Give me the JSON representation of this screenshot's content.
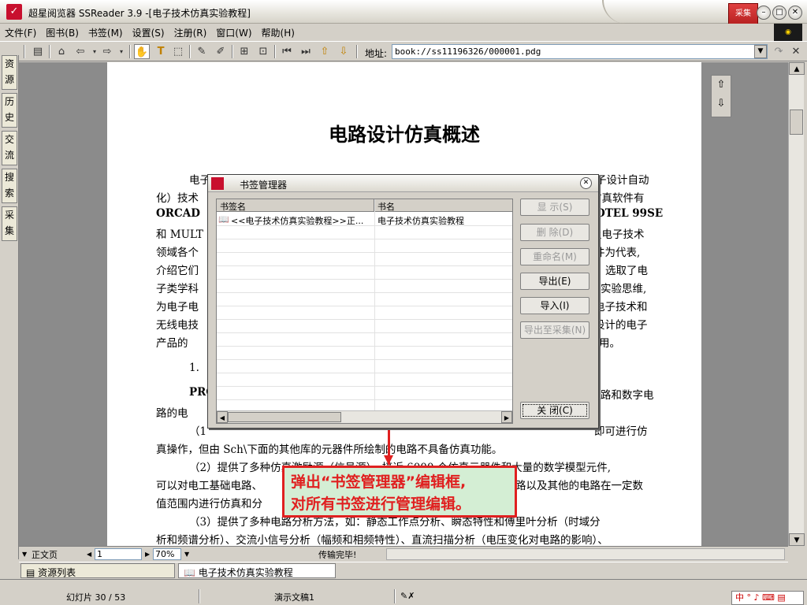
{
  "window": {
    "title": "超星阅览器 SSReader 3.9 -[电子技术仿真实验教程]",
    "badge_text": "采集"
  },
  "menu": [
    "文件(F)",
    "图书(B)",
    "书签(M)",
    "设置(S)",
    "注册(R)",
    "窗口(W)",
    "帮助(H)"
  ],
  "toolbar": {
    "address_label": "地址:",
    "address_value": "book://ss11196326/000001.pdg",
    "text_tool": "T"
  },
  "left_tabs": [
    "资源",
    "历史",
    "交流",
    "搜索",
    "采集"
  ],
  "document": {
    "title": "电路设计仿真概述",
    "lines": [
      "电子",
      "子设计自动",
      "化）技术",
      "仿真软件有",
      "ORCAD",
      "OTEL 99SE",
      "和 MULT",
      "及电子技术",
      "领域各个",
      "件为代表,",
      "介绍它们",
      "选取了电",
      "子类学科",
      "实验思维,",
      "为电子电",
      "电子技术和",
      "无线电技",
      "设计的电子",
      "产品的",
      "用。",
      "1.",
      "PRO",
      "路和数字电",
      "路的电",
      "（1",
      "即可进行仿",
      "真操作，但由 Sch\\下面的其他库的元器件所绘制的电路不具备仿真功能。",
      "（2）提供了多种仿真激励源（信号源），接近 6000 个仿真元器件和大量的数学模型元件,",
      "可以对电工基础电路、",
      "路以及其他的电路在一定数",
      "值范围内进行仿真和分",
      "（3）提供了多种电路分析方法，如：静态工作点分析、瞬态特性和傅里叶分析（时域分",
      "析和频谱分析）、交流小信号分析（幅频和相频特性）、直流扫描分析（电压变化对电路的影响）、"
    ]
  },
  "callout": {
    "line1": "弹出“书签管理器”编辑框,",
    "line2": "对所有书签进行管理编辑。"
  },
  "dialog": {
    "title": "书签管理器",
    "columns": [
      "书签名",
      "书名"
    ],
    "rows": [
      {
        "bookmark": "<<电子技术仿真实验教程>>正...",
        "book": "电子技术仿真实验教程"
      }
    ],
    "buttons": {
      "show": "显  示(S)",
      "delete": "删  除(D)",
      "rename": "重命名(M)",
      "export": "导出(E)",
      "import": "导入(I)",
      "export_collect": "导出至采集(N)",
      "close": "关  闭(C)"
    }
  },
  "statusbar": {
    "view_mode": "正文页",
    "page": "1",
    "zoom": "70%",
    "transfer": "传输完毕!"
  },
  "bottom_tabs": {
    "resource_list": "资源列表",
    "book_tab": "电子技术仿真实验教程"
  },
  "taskbar": {
    "slide": "幻灯片 30 / 53",
    "doc": "演示文稿1",
    "ime": "中 ° ♪ ⌨ ▤"
  },
  "colors": {
    "accent_red": "#e02020",
    "callout_bg": "#d4eed4",
    "brand_red": "#c8102e"
  }
}
